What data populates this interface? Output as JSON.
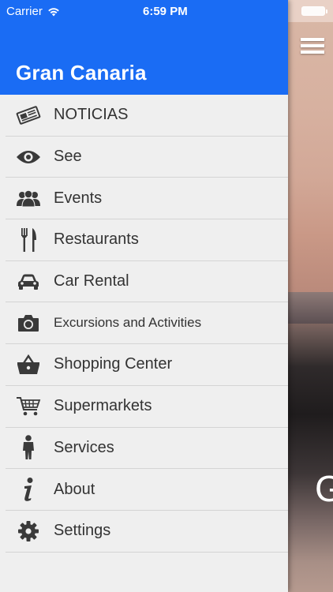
{
  "status_bar": {
    "carrier": "Carrier",
    "time": "6:59 PM"
  },
  "drawer": {
    "title": "Gran Canaria",
    "header_color": "#1a6cf4"
  },
  "menu": {
    "items": [
      {
        "label": "NOTICIAS",
        "icon": "newspaper-icon"
      },
      {
        "label": "See",
        "icon": "eye-icon"
      },
      {
        "label": "Events",
        "icon": "people-group-icon"
      },
      {
        "label": "Restaurants",
        "icon": "fork-knife-icon"
      },
      {
        "label": "Car Rental",
        "icon": "car-icon"
      },
      {
        "label": "Excursions and Activities",
        "icon": "camera-icon"
      },
      {
        "label": "Shopping Center",
        "icon": "basket-icon"
      },
      {
        "label": "Supermarkets",
        "icon": "shopping-cart-icon"
      },
      {
        "label": "Services",
        "icon": "person-icon"
      },
      {
        "label": "About",
        "icon": "info-icon"
      },
      {
        "label": "Settings",
        "icon": "gear-icon"
      }
    ]
  },
  "background": {
    "partial_title": "G"
  }
}
